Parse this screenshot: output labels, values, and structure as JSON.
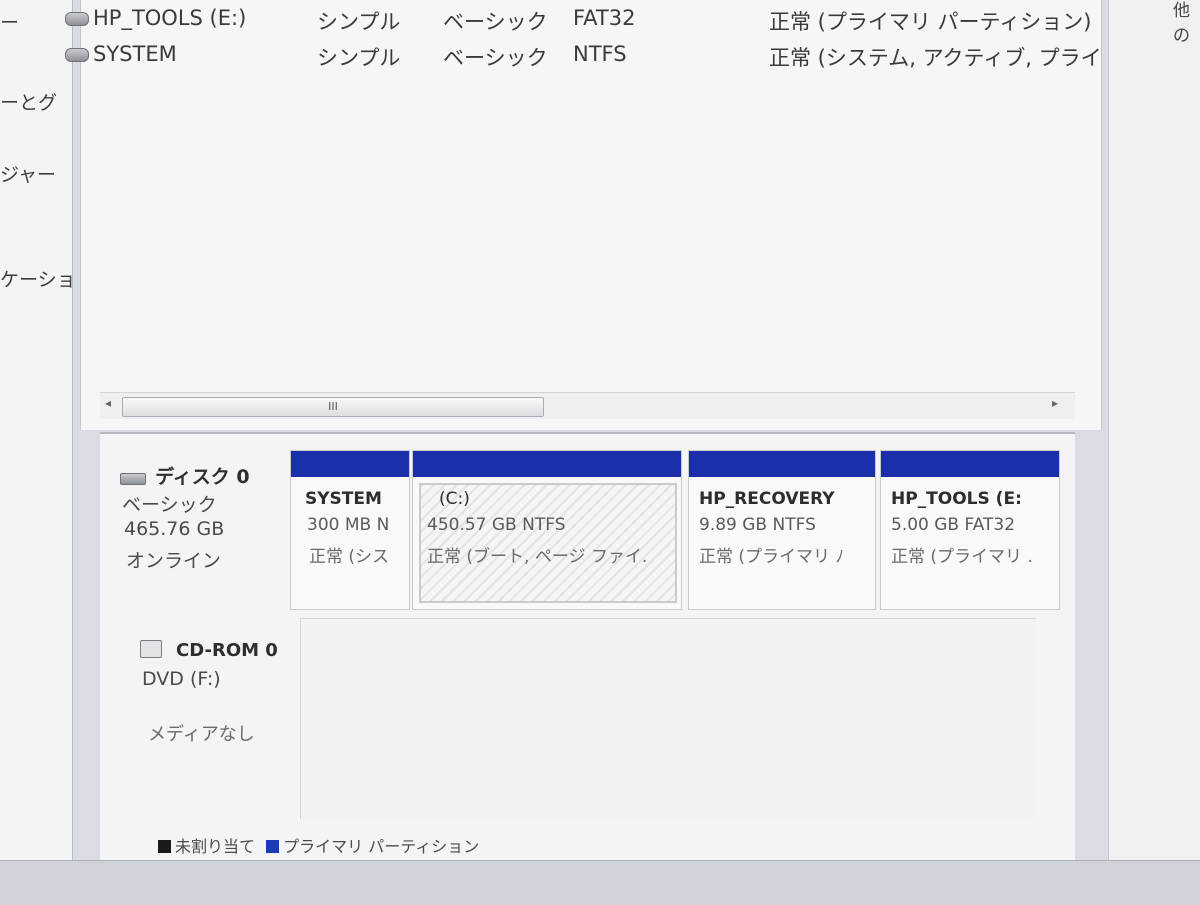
{
  "left_nav": {
    "items": [
      "ー",
      "ーとグ",
      "ジャー",
      "ケーショ"
    ]
  },
  "corner_text": "他の",
  "volume_list": {
    "rows": [
      {
        "name": "HP_TOOLS (E:)",
        "layout": "シンプル",
        "type": "ベーシック",
        "fs": "FAT32",
        "status": "正常 (プライマリ パーティション)"
      },
      {
        "name": "SYSTEM",
        "layout": "シンプル",
        "type": "ベーシック",
        "fs": "NTFS",
        "status": "正常 (システム, アクティブ, プライ"
      }
    ]
  },
  "scrollbar": {
    "thumb_glyph": "III",
    "left_arrow": "◂",
    "right_arrow": "▸"
  },
  "disks": [
    {
      "title": "ディスク 0",
      "type": "ベーシック",
      "size": "465.76 GB",
      "state": "オンライン"
    },
    {
      "title": "CD-ROM 0",
      "type": "DVD (F:)",
      "state": "メディアなし"
    }
  ],
  "partitions": [
    {
      "name": "SYSTEM",
      "size": "300 MB N",
      "status": "正常 (シス"
    },
    {
      "name": "(C:)",
      "size": "450.57 GB NTFS",
      "status": "正常 (ブート, ページ ファイ."
    },
    {
      "name": "HP_RECOVERY",
      "size": "9.89 GB NTFS",
      "status": "正常 (プライマリ ﾉ"
    },
    {
      "name": "HP_TOOLS  (E:",
      "size": "5.00 GB FAT32",
      "status": "正常 (プライマリ ."
    }
  ],
  "legend": {
    "unallocated": "未割り当て",
    "primary": "プライマリ パーティション"
  },
  "colors": {
    "partition_bar": "#1b2fa8",
    "unallocated_swatch": "#1a1a1a",
    "primary_swatch": "#1b3ab8"
  }
}
